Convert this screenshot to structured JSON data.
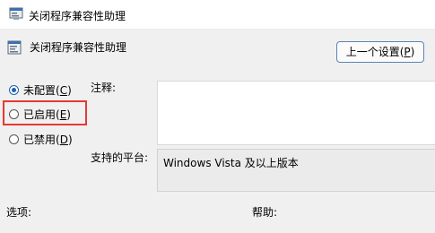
{
  "window": {
    "title": "关闭程序兼容性助理",
    "icon": "policy-settings-icon"
  },
  "header": {
    "setting_name": "关闭程序兼容性助理",
    "icon": "policy-settings-icon",
    "prev_button_text": "上一个设置(",
    "prev_button_key": "P",
    "prev_button_end": ")"
  },
  "options": [
    {
      "label": "未配置(",
      "key": "C",
      "end": ")",
      "checked": true
    },
    {
      "label": "已启用(",
      "key": "E",
      "end": ")",
      "checked": false
    },
    {
      "label": "已禁用(",
      "key": "D",
      "end": ")",
      "checked": false
    }
  ],
  "labels": {
    "comment": "注释:",
    "supported_on": "支持的平台:",
    "options": "选项:",
    "help": "帮助:"
  },
  "comment_value": "",
  "supported_platforms": "Windows Vista 及以上版本",
  "colors": {
    "highlight": "#e53935",
    "accent": "#1f5fb0"
  }
}
